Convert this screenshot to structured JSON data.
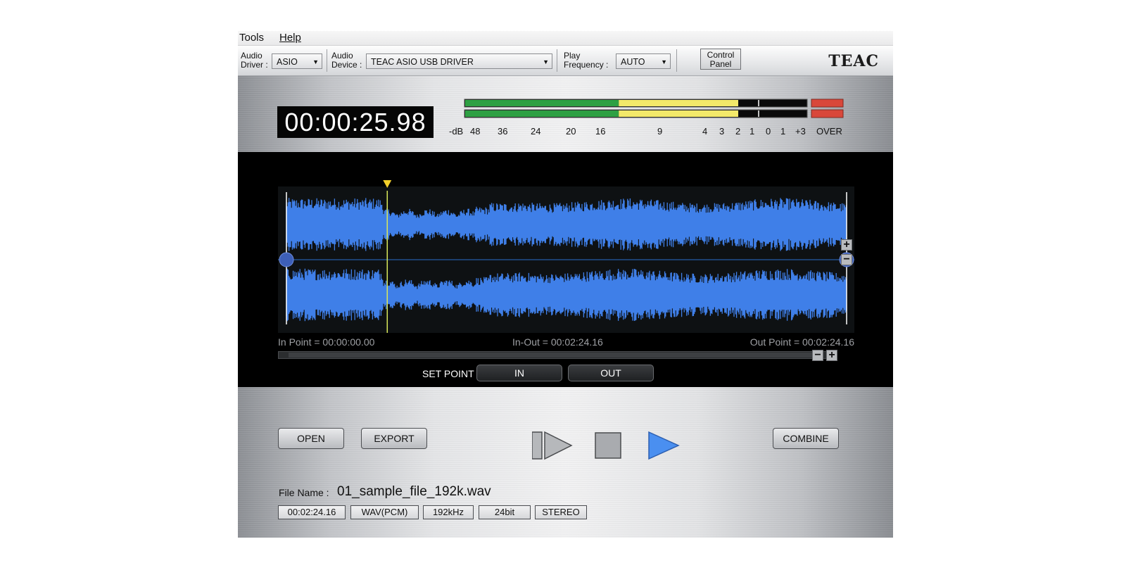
{
  "menu": {
    "tools": "Tools",
    "help": "Help"
  },
  "toolbar": {
    "audio_driver_label_1": "Audio",
    "audio_driver_label_2": "Driver :",
    "audio_driver_value": "ASIO",
    "audio_device_label_1": "Audio",
    "audio_device_label_2": "Device :",
    "audio_device_value": "TEAC ASIO USB DRIVER",
    "play_freq_label_1": "Play",
    "play_freq_label_2": "Frequency :",
    "play_freq_value": "AUTO",
    "control_panel_1": "Control",
    "control_panel_2": "Panel",
    "brand": "TEAC"
  },
  "display": {
    "timecode": "00:00:25.98",
    "meter_scale": [
      "-dB",
      "48",
      "36",
      "24",
      "20",
      "16",
      "9",
      "4",
      "3",
      "2",
      "1",
      "0",
      "1",
      "+3",
      "OVER"
    ],
    "meter_level_green": 0.45,
    "meter_level_yellow": 0.8,
    "colors": {
      "green": "#2ea043",
      "yellow": "#f3e96a",
      "over": "#d9473a"
    }
  },
  "waveform": {
    "in_point": "In Point = 00:00:00.00",
    "in_out": "In-Out = 00:02:24.16",
    "out_point": "Out Point = 00:02:24.16",
    "playhead_position": 0.18,
    "wave_color": "#3f7fe8",
    "zoom_in_icon": "plus-icon",
    "zoom_out_icon": "minus-icon"
  },
  "setpoint": {
    "label": "SET POINT",
    "in": "IN",
    "out": "OUT"
  },
  "buttons": {
    "open": "OPEN",
    "export": "EXPORT",
    "combine": "COMBINE"
  },
  "transport": {
    "icons": [
      "play-from-start-icon",
      "stop-icon",
      "play-icon"
    ]
  },
  "file": {
    "label": "File Name :",
    "name": "01_sample_file_192k.wav",
    "duration": "00:02:24.16",
    "format": "WAV(PCM)",
    "rate": "192kHz",
    "bits": "24bit",
    "channels": "STEREO"
  }
}
